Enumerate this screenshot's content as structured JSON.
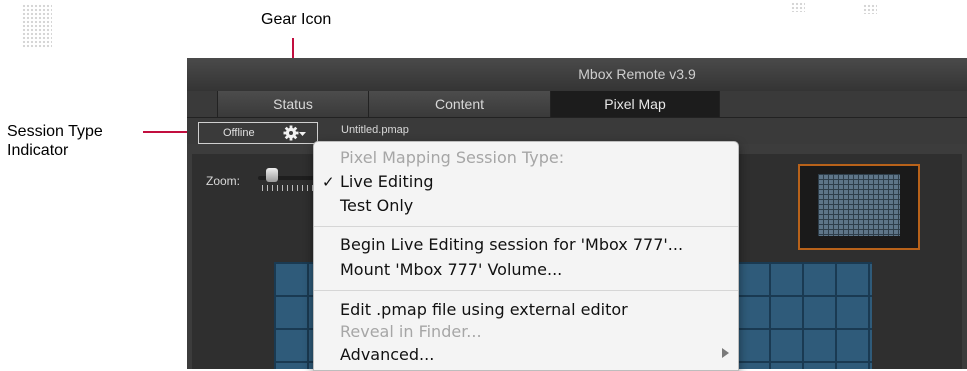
{
  "callouts": {
    "gear_icon": "Gear Icon",
    "session_type_line1": "Session Type",
    "session_type_line2": "Indicator"
  },
  "window": {
    "title": "Mbox Remote v3.9",
    "tabs": [
      {
        "label": "Status",
        "active": false
      },
      {
        "label": "Content",
        "active": false
      },
      {
        "label": "Pixel Map",
        "active": true
      }
    ]
  },
  "toolbar": {
    "session_status": "Offline",
    "gear_icon": "gear-icon",
    "filename": "Untitled.pmap"
  },
  "content": {
    "zoom_label": "Zoom:"
  },
  "menu": {
    "header": "Pixel Mapping Session Type:",
    "live_editing": "Live Editing",
    "live_editing_checked": true,
    "test_only": "Test Only",
    "begin_session": "Begin Live Editing session for 'Mbox 777'...",
    "mount_volume": "Mount 'Mbox 777' Volume...",
    "edit_external": "Edit .pmap file using external editor",
    "reveal_finder": "Reveal in Finder...",
    "advanced": "Advanced..."
  },
  "colors": {
    "callout_line": "#c20e3f",
    "preview_border": "#b8621a",
    "grid_blue": "#2f5b7a"
  }
}
